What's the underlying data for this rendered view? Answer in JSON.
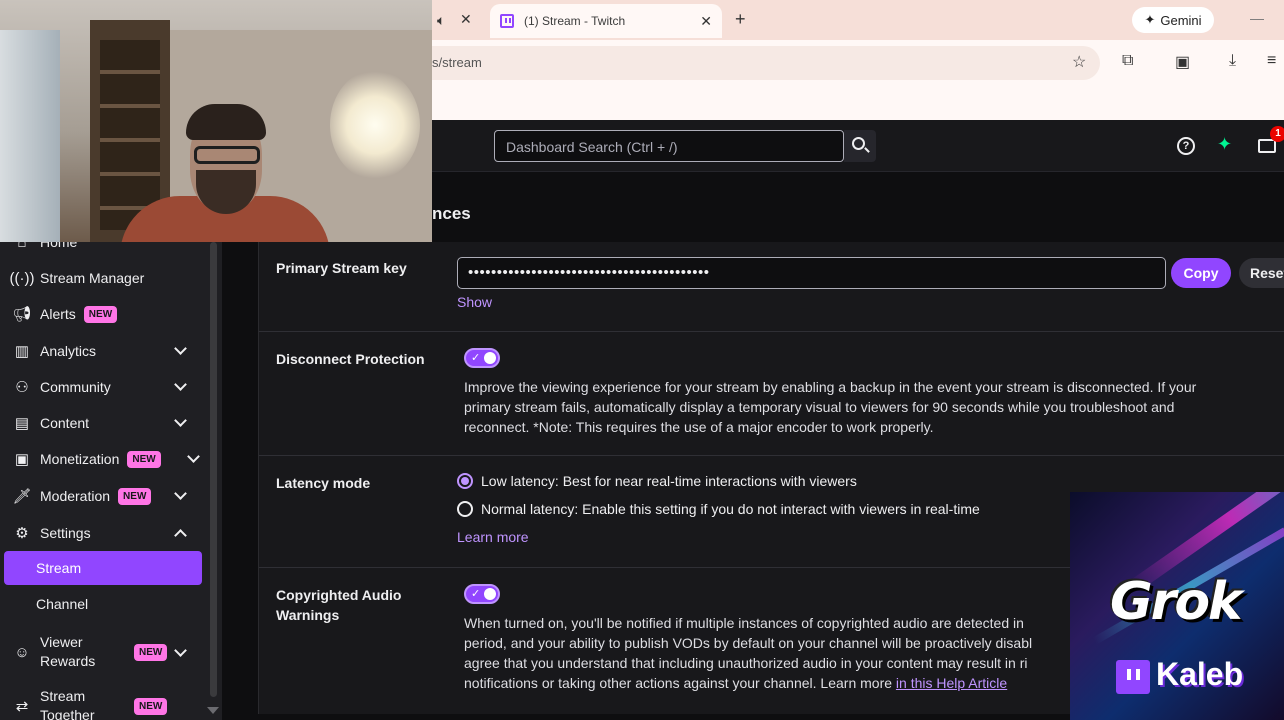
{
  "browser": {
    "tab_title": "(1) Stream - Twitch",
    "tab_close": "✕",
    "new_tab": "+",
    "gemini_label": "Gemini",
    "url_fragment": "s/stream",
    "minimize": "—"
  },
  "topnav": {
    "search_placeholder": "Dashboard Search (Ctrl + /)",
    "help_glyph": "?",
    "inbox_badge": "1"
  },
  "section_heading": "nces",
  "sidebar": {
    "items": [
      {
        "label": "Home"
      },
      {
        "label": "Stream Manager"
      },
      {
        "label": "Alerts",
        "badge": "NEW"
      },
      {
        "label": "Analytics"
      },
      {
        "label": "Community"
      },
      {
        "label": "Content"
      },
      {
        "label": "Monetization",
        "badge": "NEW"
      },
      {
        "label": "Moderation",
        "badge": "NEW"
      },
      {
        "label": "Settings"
      },
      {
        "label": "Stream"
      },
      {
        "label": "Channel"
      },
      {
        "label": "Viewer Rewards",
        "badge": "NEW"
      },
      {
        "label": "Stream Together",
        "badge": "NEW"
      }
    ]
  },
  "stream_key": {
    "label": "Primary Stream key",
    "masked_value": "••••••••••••••••••••••••••••••••••••••••••",
    "copy_label": "Copy",
    "reset_label": "Reset",
    "show_label": "Show"
  },
  "disconnect_protection": {
    "label": "Disconnect Protection",
    "enabled": true,
    "line1": "Improve the viewing experience for your stream by enabling a backup in the event your stream is disconnected. If your",
    "line2": "primary stream fails, automatically display a temporary visual to viewers for 90 seconds while you troubleshoot and",
    "line3": "reconnect. *Note: This requires the use of a major encoder to work properly."
  },
  "latency": {
    "label": "Latency mode",
    "low_label": "Low latency: Best for near real-time interactions with viewers",
    "normal_label": "Normal latency: Enable this setting if you do not interact with viewers in real-time",
    "selected": "low",
    "learn_more": "Learn more"
  },
  "copyright": {
    "label_line1": "Copyrighted Audio",
    "label_line2": "Warnings",
    "enabled": true,
    "line1": "When turned on, you'll be notified if multiple instances of copyrighted audio are detected in",
    "line2": "period, and your ability to publish VODs by default on your channel will be proactively disabl",
    "line3": "agree that you understand that including unauthorized audio in your content may result in ri",
    "line4_prefix": "notifications or taking other actions against your channel. Learn more ",
    "help_link": "in this Help Article"
  },
  "overlay": {
    "grok_text": "Grok",
    "kaleb_text": "Kaleb"
  },
  "colors": {
    "accent": "#9146ff",
    "accent_light": "#bf94ff",
    "badge_new": "#ff75e6",
    "background": "#0e0e10",
    "card": "#18181b"
  }
}
